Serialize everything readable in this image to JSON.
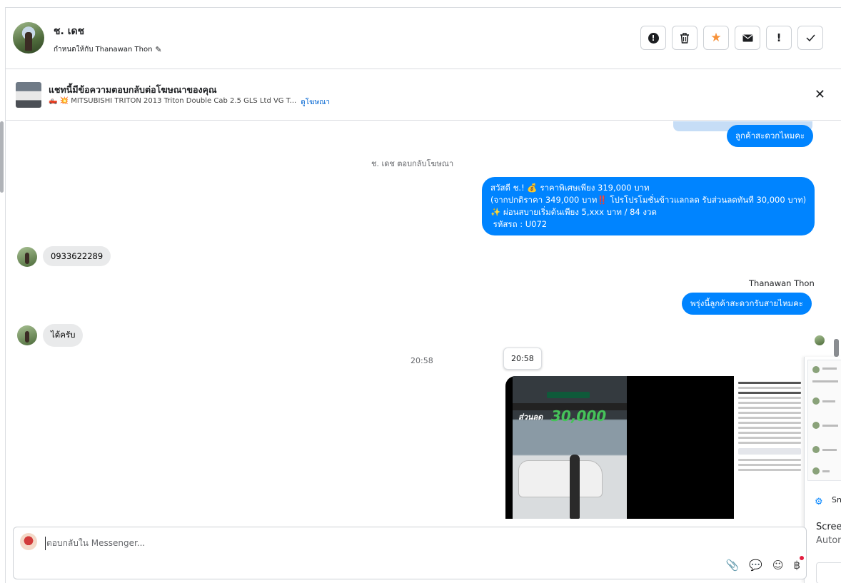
{
  "header": {
    "contact_name": "ช. เดช",
    "assigned_label": "กำหนดให้กับ Thanawan Thon",
    "actions": [
      {
        "name": "spam",
        "icon": "alert-circle-icon"
      },
      {
        "name": "delete",
        "icon": "trash-icon"
      },
      {
        "name": "star",
        "icon": "star-icon",
        "color": "#f7923a"
      },
      {
        "name": "mark-unread",
        "icon": "envelope-icon"
      },
      {
        "name": "follow-up",
        "icon": "exclamation-icon"
      },
      {
        "name": "done",
        "icon": "check-icon"
      }
    ]
  },
  "ad_banner": {
    "title": "แชทนี้มีข้อความตอบกลับต่อโฆษณาของคุณ",
    "subtitle": "🛻 💥 MITSUBISHI TRITON 2013 Triton Double Cab 2.5 GLS Ltd VG T...",
    "link": "ดูโฆษณา"
  },
  "chat": {
    "prev_bubble": "ลูกค้าสะดวกไหมคะ",
    "system_note": "ช. เดช ตอบกลับโฆษณา",
    "promo_lines": [
      "สวัสดี ช.! 💰 ราคาพิเศษเพียง 319,000 บาท",
      "(จากปกติราคา 349,000 บาท‼️ โปรโปรโมชั่นข้าวแลกลด รับส่วนลดทันที 30,000 บาท)",
      "✨ ผ่อนสบายเริ่มต้นเพียง 5,xxx บาท / 84 งวด",
      " รหัสรถ : U072"
    ],
    "phone_msg": "0933622289",
    "agent_name": "Thanawan Thon",
    "agent_msg": "พรุ่งนี้ลูกค้าสะดวกรับสายไหมคะ",
    "reply_msg": "ได้ครับ",
    "timestamp": "20:58",
    "tooltip_time": "20:58",
    "media": {
      "promo_text": "ส่วนลด",
      "promo_amount": "30,000"
    }
  },
  "overlay": {
    "label1": "Sn",
    "label2": "Screen",
    "label3": "Autom"
  },
  "composer": {
    "placeholder": "ตอบกลับใน Messenger..."
  },
  "colors": {
    "accent": "#0084ff",
    "incoming": "#e9eaeb",
    "star": "#f7923a"
  }
}
